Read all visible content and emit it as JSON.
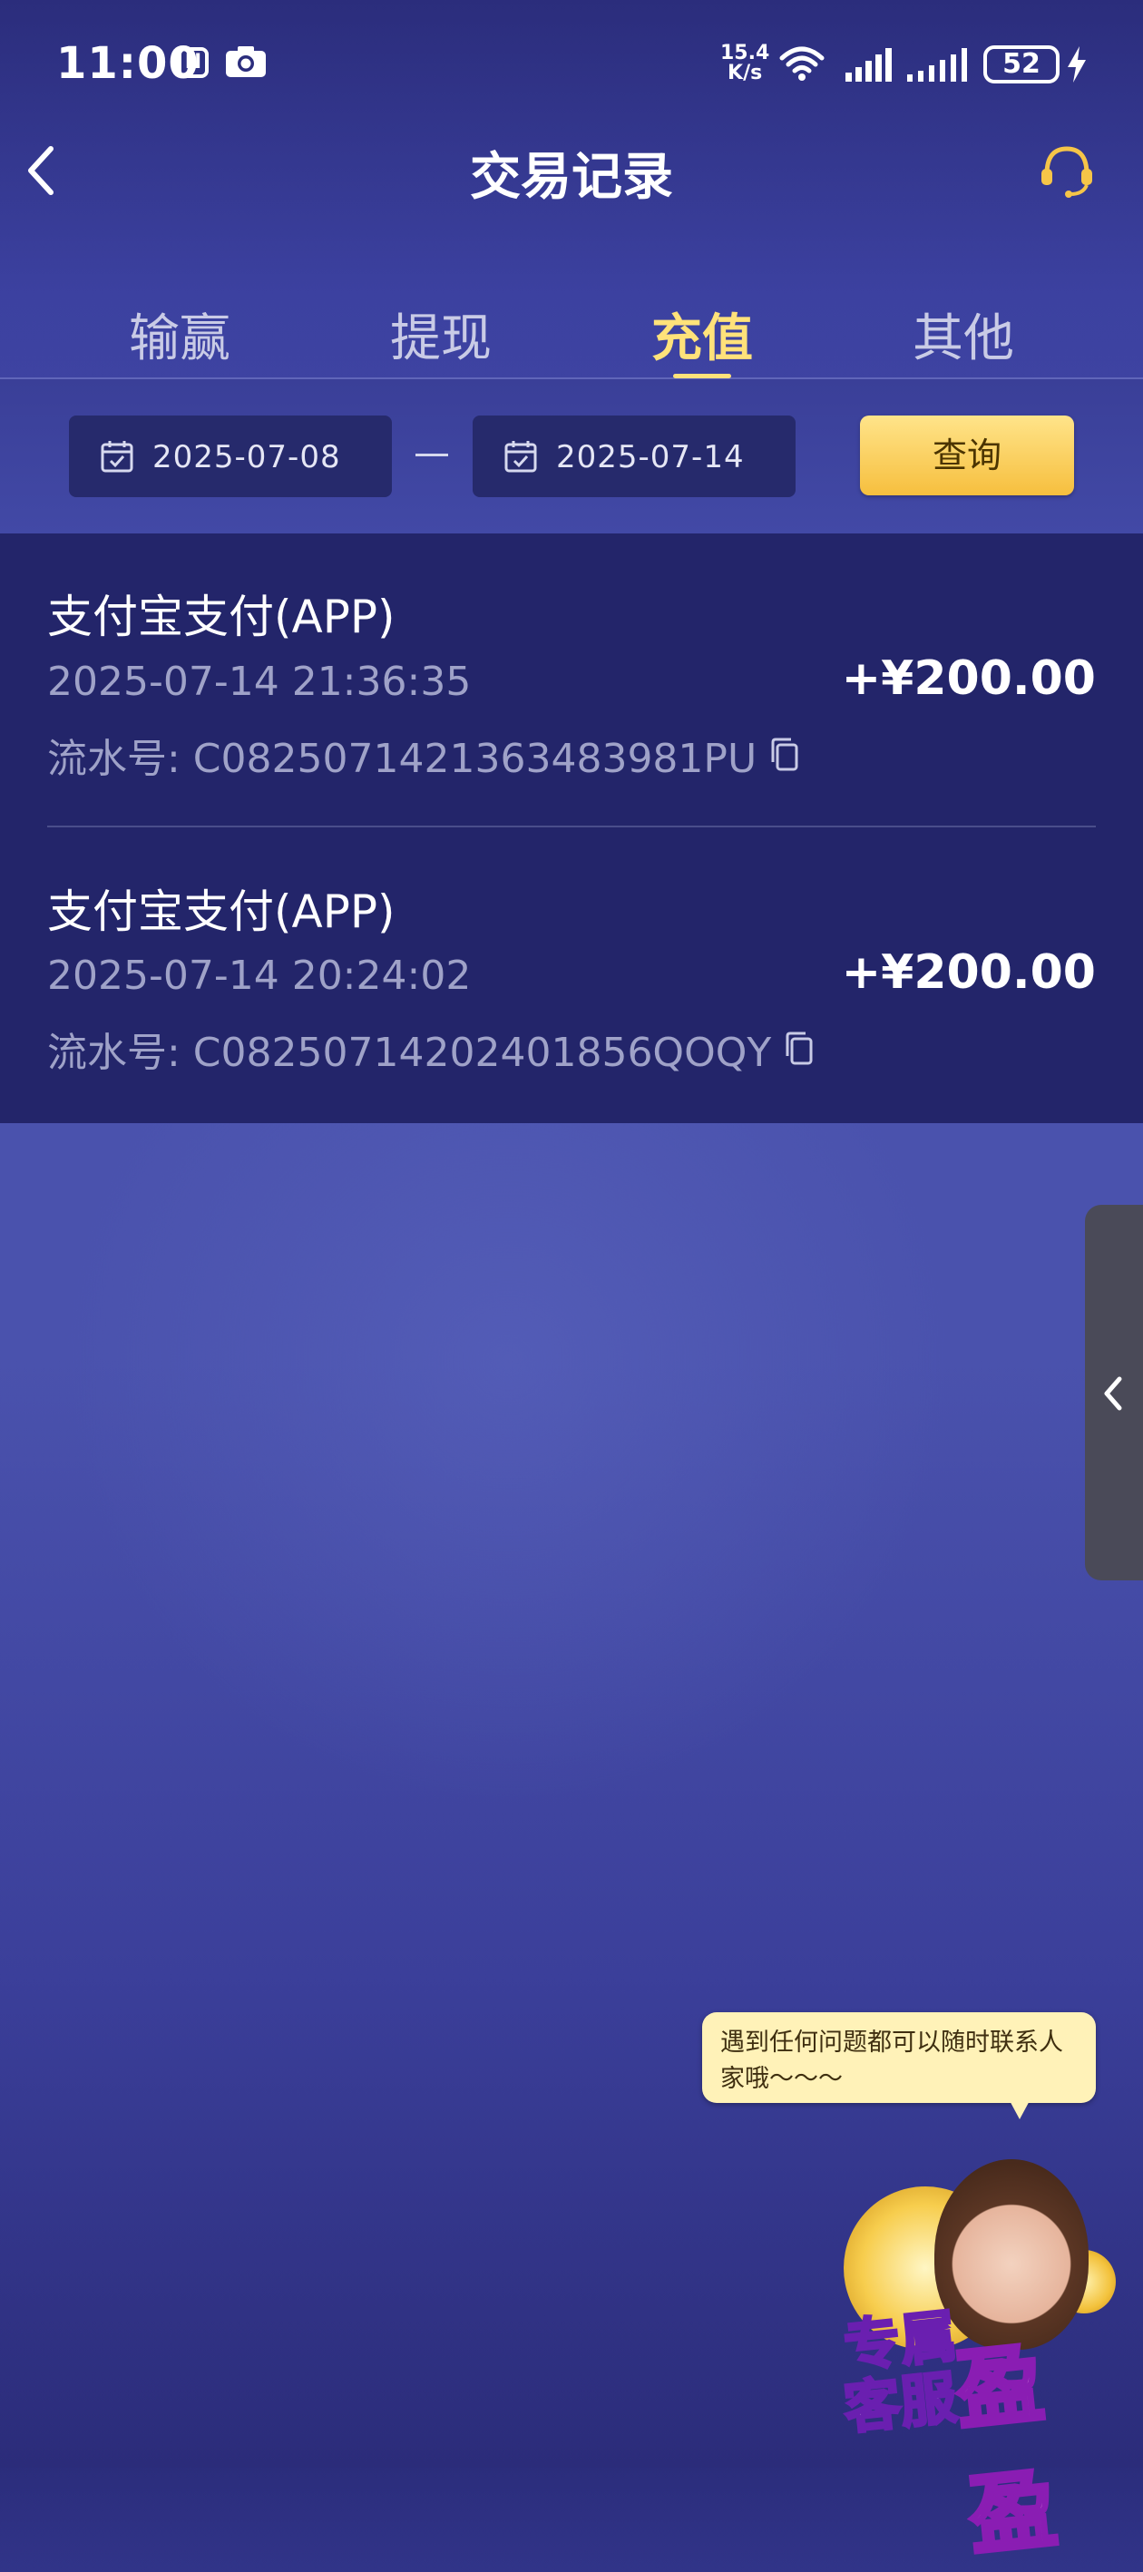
{
  "status_bar": {
    "time": "11:00",
    "net_speed_value": "15.4",
    "net_speed_unit": "K/s",
    "battery": "52",
    "icons": [
      "nfc-icon",
      "camera-icon",
      "wifi-icon",
      "signal-icon",
      "signal-icon",
      "charging-icon"
    ]
  },
  "header": {
    "title": "交易记录",
    "back_icon": "chevron-left-icon",
    "support_icon": "headset-icon"
  },
  "tabs": [
    {
      "label": "输赢",
      "active": false
    },
    {
      "label": "提现",
      "active": false
    },
    {
      "label": "充值",
      "active": true
    },
    {
      "label": "其他",
      "active": false
    }
  ],
  "filter": {
    "start_date": "2025-07-08",
    "end_date": "2025-07-14",
    "separator": "—",
    "query_label": "查询"
  },
  "records": [
    {
      "title": "支付宝支付(APP)",
      "time": "2025-07-14 21:36:35",
      "serial": "流水号: C0825071421363483981PU",
      "amount": "+¥200.00"
    },
    {
      "title": "支付宝支付(APP)",
      "time": "2025-07-14 20:24:02",
      "serial": "流水号: C08250714202401856QOQY",
      "amount": "+¥200.00"
    }
  ],
  "support_widget": {
    "bubble_text": "遇到任何问题都可以随时联系人家哦～～～",
    "badge_line1": "专属",
    "badge_line2": "客服",
    "badge_name": "盈盈"
  },
  "colors": {
    "accent": "#ffe27a",
    "button_gradient_top": "#ffe48a",
    "button_gradient_bottom": "#f6bf3e",
    "record_bg": "#23256a"
  }
}
